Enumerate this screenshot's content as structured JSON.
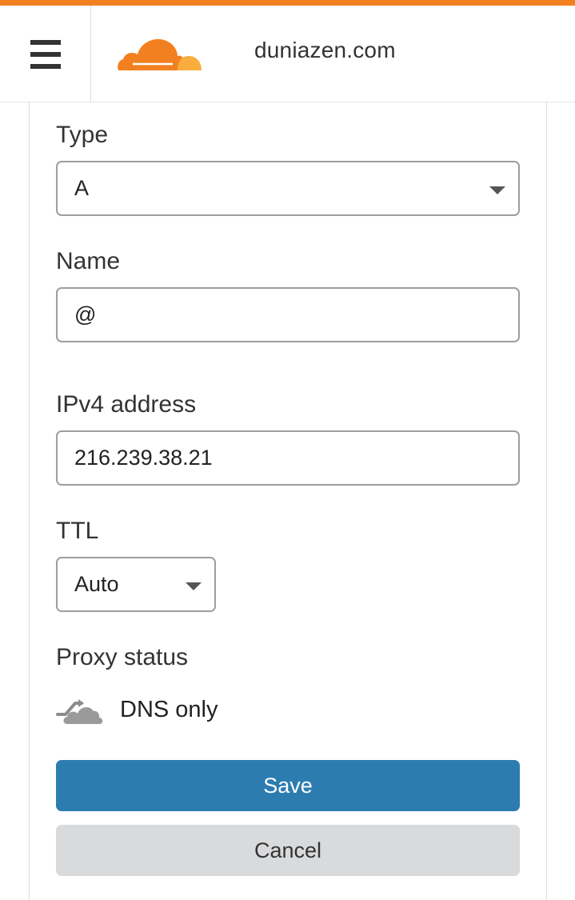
{
  "header": {
    "domain": "duniazen.com",
    "menu_icon": "hamburger-menu-icon",
    "logo_icon": "cloudflare-logo-icon",
    "accent_color": "#f38020"
  },
  "form": {
    "type": {
      "label": "Type",
      "value": "A"
    },
    "name": {
      "label": "Name",
      "value": "@"
    },
    "ipv4": {
      "label": "IPv4 address",
      "value": "216.239.38.21"
    },
    "ttl": {
      "label": "TTL",
      "value": "Auto"
    },
    "proxy": {
      "label": "Proxy status",
      "value": "DNS only",
      "icon": "dns-only-cloud-icon"
    }
  },
  "actions": {
    "save_label": "Save",
    "cancel_label": "Cancel",
    "save_color": "#2c7cb0",
    "cancel_color": "#d9dadc"
  }
}
